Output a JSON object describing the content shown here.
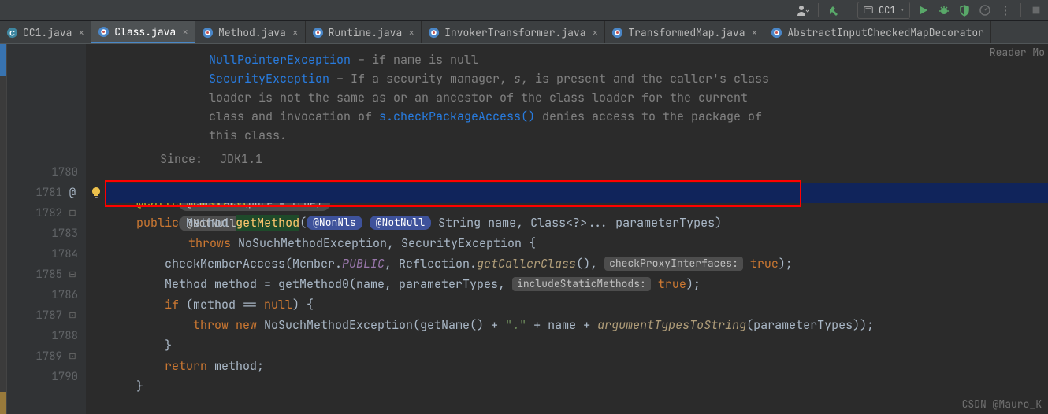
{
  "toolbar": {
    "run_config": "CC1"
  },
  "tabs": [
    {
      "label": "CC1.java",
      "icon": "class",
      "active": false,
      "closable": true
    },
    {
      "label": "Class.java",
      "icon": "java",
      "active": true,
      "closable": true
    },
    {
      "label": "Method.java",
      "icon": "java",
      "active": false,
      "closable": true
    },
    {
      "label": "Runtime.java",
      "icon": "java",
      "active": false,
      "closable": true
    },
    {
      "label": "InvokerTransformer.java",
      "icon": "java",
      "active": false,
      "closable": true
    },
    {
      "label": "TransformedMap.java",
      "icon": "java",
      "active": false,
      "closable": true
    },
    {
      "label": "AbstractInputCheckedMapDecorator",
      "icon": "java",
      "active": false,
      "closable": false
    }
  ],
  "doc": {
    "npe_link": "NullPointerException",
    "npe_text": " – if name is null",
    "se_link": "SecurityException",
    "se_text_a": " – If a security manager, ",
    "se_text_s": "s",
    "se_text_b": ", is present and the caller's class loader is not the same as or an ancestor of the class loader for the current class and invocation of ",
    "se_text_c": "s.checkPackageAccess()",
    "se_text_d": " denies access to the package of this class.",
    "since_label": "Since:",
    "since_value": "JDK1.1"
  },
  "badges": {
    "contract": "@Contract(pure = true)",
    "notnull": "@NotNull"
  },
  "code": {
    "l1780": {
      "ann": "@CallerSensitive"
    },
    "l1781": {
      "kw_public": "public",
      "type_method": "Method",
      "name": "getMethod",
      "p_nonnls": "@NonNls",
      "p_notnull": "@NotNull",
      "sig_rest": "String name, Class<?>... parameterTypes)"
    },
    "l1782": {
      "kw_throws": "throws",
      "rest": "NoSuchMethodException, SecurityException {"
    },
    "l1783": {
      "call": "checkMemberAccess(Member.",
      "public": "PUBLIC",
      "mid": ", Reflection.",
      "getcaller": "getCallerClass",
      "mid2": "(), ",
      "hint": "checkProxyInterfaces:",
      "true": "true",
      "end": ");"
    },
    "l1784": {
      "a": "Method method = getMethod0(name, parameterTypes, ",
      "hint": "includeStaticMethods:",
      "true": "true",
      "end": ");"
    },
    "l1785": {
      "kw_if": "if",
      "cond": " (method == ",
      "null": "null",
      "end": ") {"
    },
    "l1786": {
      "kw_throw": "throw",
      "kw_new": "new",
      "a": " NoSuchMethodException(getName() + ",
      "str": "\".\"",
      "b": " + name + ",
      "atts": "argumentTypesToString",
      "c": "(parameterTypes));"
    },
    "l1787": {
      "brace": "}"
    },
    "l1788": {
      "kw_return": "return",
      "rest": " method;"
    },
    "l1789": {
      "brace": "}"
    }
  },
  "gutter": {
    "lines": [
      "1780",
      "1781",
      "1782",
      "1783",
      "1784",
      "1785",
      "1786",
      "1787",
      "1788",
      "1789",
      "1790",
      ""
    ],
    "at_line": "@"
  },
  "reader_mode": "Reader Mo",
  "watermark": "CSDN @Mauro_K"
}
